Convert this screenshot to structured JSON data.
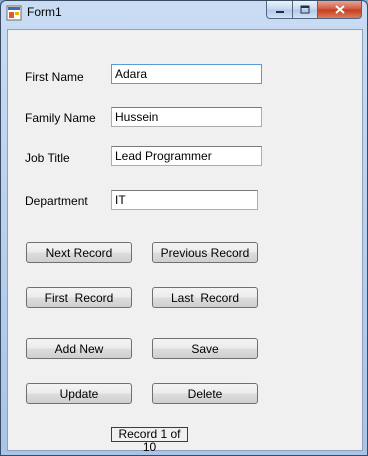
{
  "window": {
    "title": "Form1"
  },
  "caption_buttons": {
    "minimize": "minimize-icon",
    "maximize": "maximize-icon",
    "close": "close-icon"
  },
  "form": {
    "fields": [
      {
        "label": "First Name",
        "value": "Adara"
      },
      {
        "label": "Family Name",
        "value": "Hussein"
      },
      {
        "label": "Job Title",
        "value": "Lead Programmer"
      },
      {
        "label": "Department",
        "value": "IT"
      }
    ],
    "buttons": {
      "next": "Next Record",
      "previous": "Previous Record",
      "first": "First  Record",
      "last": "Last  Record",
      "add_new": "Add New",
      "save": "Save",
      "update": "Update",
      "delete": "Delete"
    },
    "status": "Record 1 of 10"
  },
  "colors": {
    "title_bar": "#b9d1ef",
    "client_bg": "#f0f0f0",
    "close_button": "#c9452a"
  }
}
